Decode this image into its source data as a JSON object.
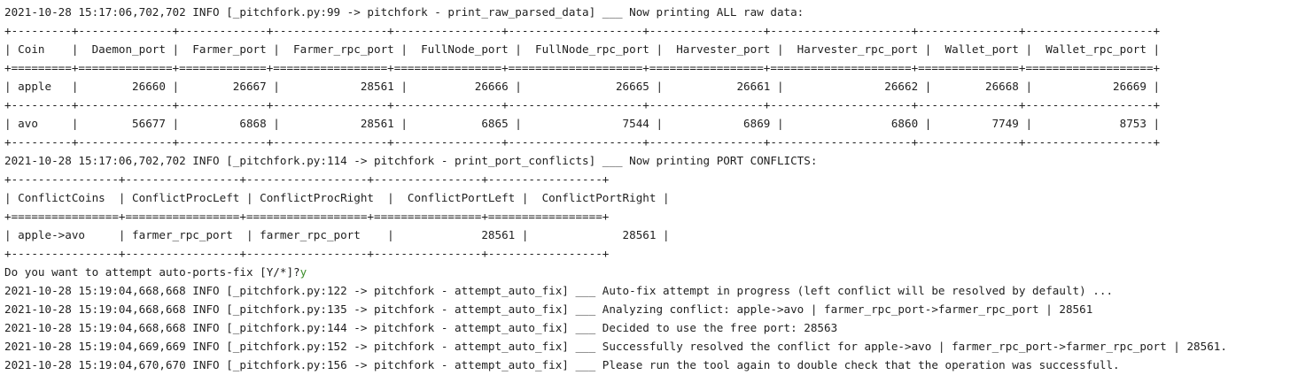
{
  "log_header_1": "2021-10-28 15:17:06,702,702 INFO [_pitchfork.py:99 -> pitchfork - print_raw_parsed_data] ___ Now printing ALL raw data:",
  "raw_table": {
    "border": "+---------+--------------+-------------+-----------------+----------------+--------------------+-----------------+---------------------+---------------+-------------------+",
    "header_row": "| Coin    |  Daemon_port |  Farmer_port |  Farmer_rpc_port |  FullNode_port |  FullNode_rpc_port |  Harvester_port |  Harvester_rpc_port |  Wallet_port |  Wallet_rpc_port |",
    "header_sep": "+=========+==============+=============+=================+================+====================+=================+=====================+===============+===================+",
    "rows": [
      "| apple   |        26660 |        26667 |            28561 |          26666 |              26665 |           26661 |               26662 |        26668 |            26669 |",
      "| avo     |        56677 |         6868 |            28561 |           6865 |               7544 |            6869 |                6860 |         7749 |             8753 |"
    ]
  },
  "log_header_2": "2021-10-28 15:17:06,702,702 INFO [_pitchfork.py:114 -> pitchfork - print_port_conflicts] ___ Now printing PORT CONFLICTS:",
  "conflict_table": {
    "border": "+----------------+-----------------+------------------+----------------+-----------------+",
    "header_row": "| ConflictCoins  | ConflictProcLeft | ConflictProcRight  |  ConflictPortLeft |  ConflictPortRight |",
    "header_sep": "+================+=================+==================+================+=================+",
    "rows": [
      "| apple->avo     | farmer_rpc_port  | farmer_rpc_port    |             28561 |              28561 |"
    ]
  },
  "prompt": {
    "question": "Do you want to attempt auto-ports-fix [Y/*]?",
    "answer": "y"
  },
  "log_lines": [
    "2021-10-28 15:19:04,668,668 INFO [_pitchfork.py:122 -> pitchfork - attempt_auto_fix] ___ Auto-fix attempt in progress (left conflict will be resolved by default) ...",
    "2021-10-28 15:19:04,668,668 INFO [_pitchfork.py:135 -> pitchfork - attempt_auto_fix] ___ Analyzing conflict: apple->avo | farmer_rpc_port->farmer_rpc_port | 28561",
    "2021-10-28 15:19:04,668,668 INFO [_pitchfork.py:144 -> pitchfork - attempt_auto_fix] ___ Decided to use the free port: 28563",
    "2021-10-28 15:19:04,669,669 INFO [_pitchfork.py:152 -> pitchfork - attempt_auto_fix] ___ Successfully resolved the conflict for apple->avo | farmer_rpc_port->farmer_rpc_port | 28561.",
    "2021-10-28 15:19:04,670,670 INFO [_pitchfork.py:156 -> pitchfork - attempt_auto_fix] ___ Please run the tool again to double check that the operation was successfull."
  ]
}
